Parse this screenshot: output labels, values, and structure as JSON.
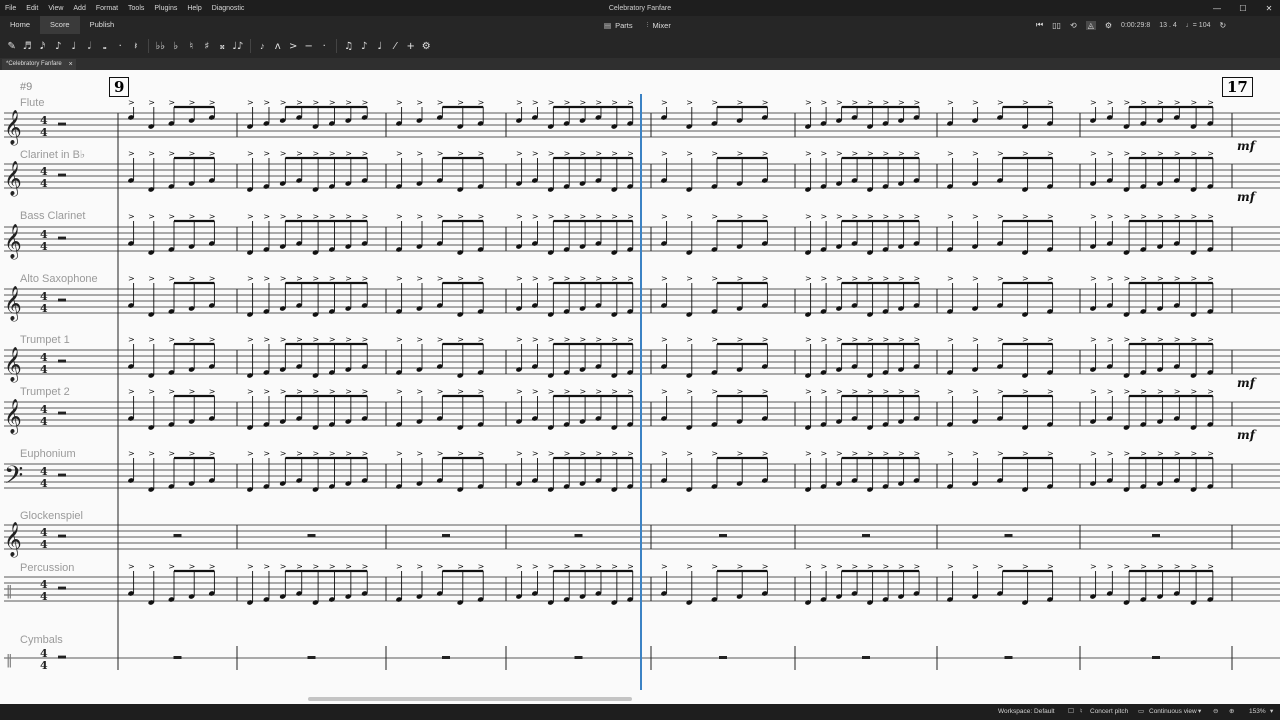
{
  "window": {
    "title": "Celebratory Fanfare"
  },
  "menu": [
    "File",
    "Edit",
    "View",
    "Add",
    "Format",
    "Tools",
    "Plugins",
    "Help",
    "Diagnostic"
  ],
  "workspace_tabs": [
    {
      "label": "Home",
      "active": false
    },
    {
      "label": "Score",
      "active": true
    },
    {
      "label": "Publish",
      "active": false
    }
  ],
  "nav": {
    "parts": "Parts",
    "mixer": "Mixer"
  },
  "playback": {
    "time": "0:00:29:8",
    "position": "13 . 4",
    "tempo": "♩= 104"
  },
  "note_toolbar": [
    "✎",
    "♬",
    "𝅘𝅥𝅯",
    "♪",
    "♩",
    "𝅗𝅥",
    "𝅝",
    "·",
    "𝄽",
    "♭♭",
    "♭",
    "♮",
    "♯",
    "𝄪",
    "♩♪",
    "𝆔",
    "ᴧ",
    ">",
    "−",
    "·",
    "♫",
    "♪",
    "♩",
    "⁄",
    "+",
    "⚙"
  ],
  "document_tab": {
    "label": "*Celebratory Fanfare",
    "close": "×"
  },
  "score": {
    "measure_label": "#9",
    "rehearsal_marks": [
      "9",
      "17"
    ],
    "instruments": [
      "Flute",
      "Clarinet in B♭",
      "Bass Clarinet",
      "Alto Saxophone",
      "Trumpet 1",
      "Trumpet 2",
      "Euphonium",
      "Glockenspiel",
      "Percussion",
      "Cymbals"
    ],
    "dynamics": [
      "mf",
      "mf",
      "mf",
      "mf"
    ]
  },
  "status": {
    "workspace": "Workspace: Default",
    "concert_pitch": "Concert pitch",
    "view_mode": "Continuous view",
    "zoom": "153%"
  }
}
